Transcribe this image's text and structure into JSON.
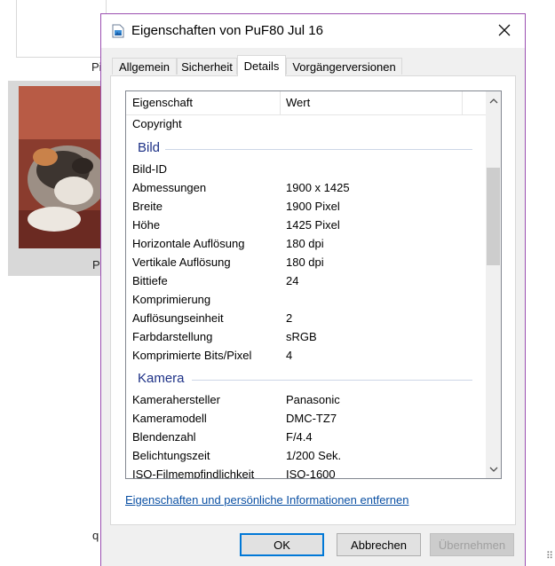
{
  "background": {
    "label_1": "Pi",
    "label_2": "P",
    "label_3": "q"
  },
  "dialog": {
    "title": "Eigenschaften von PuF80 Jul 16",
    "icon": "image-file-icon",
    "tabs": [
      {
        "label": "Allgemein"
      },
      {
        "label": "Sicherheit"
      },
      {
        "label": "Details"
      },
      {
        "label": "Vorgängerversionen"
      }
    ],
    "active_tab": "Details",
    "list": {
      "col_property": "Eigenschaft",
      "col_value": "Wert",
      "rows": [
        {
          "key": "Copyright",
          "value": ""
        },
        {
          "group": "Bild"
        },
        {
          "key": "Bild-ID",
          "value": ""
        },
        {
          "key": "Abmessungen",
          "value": "1900 x 1425"
        },
        {
          "key": "Breite",
          "value": "1900 Pixel"
        },
        {
          "key": "Höhe",
          "value": "1425 Pixel"
        },
        {
          "key": "Horizontale Auflösung",
          "value": "180 dpi"
        },
        {
          "key": "Vertikale Auflösung",
          "value": "180 dpi"
        },
        {
          "key": "Bittiefe",
          "value": "24"
        },
        {
          "key": "Komprimierung",
          "value": ""
        },
        {
          "key": "Auflösungseinheit",
          "value": "2"
        },
        {
          "key": "Farbdarstellung",
          "value": "sRGB"
        },
        {
          "key": "Komprimierte Bits/Pixel",
          "value": "4"
        },
        {
          "group": "Kamera"
        },
        {
          "key": "Kamerahersteller",
          "value": "Panasonic"
        },
        {
          "key": "Kameramodell",
          "value": "DMC-TZ7"
        },
        {
          "key": "Blendenzahl",
          "value": "F/4.4"
        },
        {
          "key": "Belichtungszeit",
          "value": "1/200 Sek."
        },
        {
          "key": "ISO-Filmempfindlichkeit",
          "value": "ISO-1600"
        }
      ]
    },
    "remove_link": "Eigenschaften und persönliche Informationen entfernen",
    "buttons": {
      "ok": "OK",
      "cancel": "Abbrechen",
      "apply": "Übernehmen"
    }
  },
  "colors": {
    "group_header": "#1e3287",
    "link": "#0b50a3",
    "window_border": "#9b4fb1",
    "focus": "#0078d7"
  }
}
